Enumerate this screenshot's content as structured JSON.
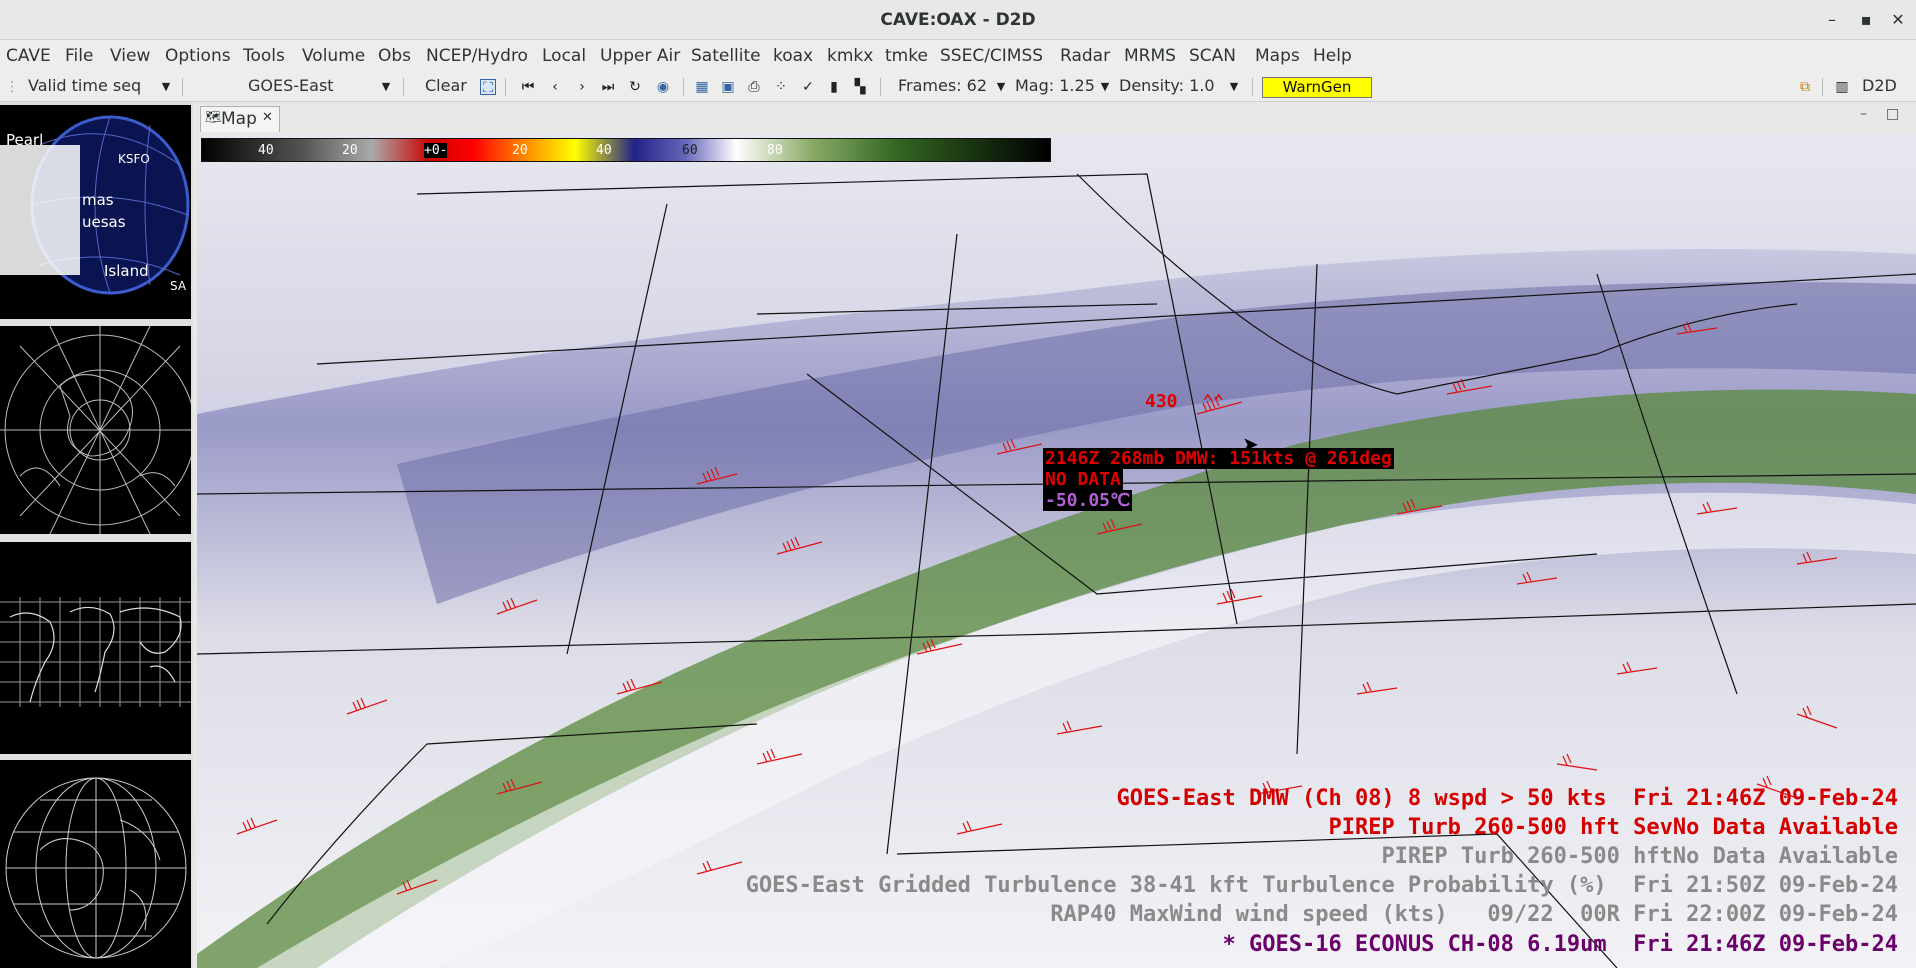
{
  "window": {
    "title": "CAVE:OAX - D2D",
    "minimize": "–",
    "maximize": "▪",
    "close": "✕"
  },
  "menu": [
    "CAVE",
    "File",
    "View",
    "Options",
    "Tools",
    "Volume",
    "Obs",
    "NCEP/Hydro",
    "Local",
    "Upper Air",
    "Satellite",
    "koax",
    "kmkx",
    "tmke",
    "SSEC/CIMSS",
    "Radar",
    "MRMS",
    "SCAN",
    "Maps",
    "Help"
  ],
  "toolbar": {
    "time_mode": "Valid time seq",
    "source": "GOES-East",
    "clear": "Clear",
    "frames": "Frames: 62",
    "mag": "Mag: 1.25",
    "density": "Density: 1.0",
    "warngen": "WarnGen",
    "perspective": "D2D"
  },
  "tab": {
    "label": "Map"
  },
  "colorbar": {
    "labels": [
      "40",
      "20",
      "+0-",
      "20",
      "40",
      "60",
      "80"
    ]
  },
  "marker": {
    "value": "430",
    "symbol": "⌃⌃"
  },
  "readout": {
    "line1": "2146Z 268mb DMW: 151kts @ 261deg",
    "line2": "NO DATA",
    "line3": "-50.05℃"
  },
  "legend": [
    {
      "text": "GOES-East DMW (Ch 08) 8 wspd > 50 kts  Fri 21:46Z 09-Feb-24",
      "color": "#d40000"
    },
    {
      "text": "PIREP Turb 260-500 hft SevNo Data Available",
      "color": "#d40000"
    },
    {
      "text": "PIREP Turb 260-500 hftNo Data Available",
      "color": "#8a8a8a"
    },
    {
      "text": "GOES-East Gridded Turbulence 38-41 kft Turbulence Probability (%)  Fri 21:50Z 09-Feb-24",
      "color": "#8a8a8a"
    },
    {
      "text": "RAP40 MaxWind wind speed (kts)   09/22  00R Fri 22:00Z 09-Feb-24",
      "color": "#8a8a8a"
    },
    {
      "text": "* GOES-16 ECONUS CH-08 6.19um  Fri 21:46Z 09-Feb-24",
      "color": "#6a006a"
    }
  ],
  "thumbnail_labels": [
    "Pearl",
    "KSFO",
    "mas",
    "uesas",
    "Island",
    "SA"
  ]
}
